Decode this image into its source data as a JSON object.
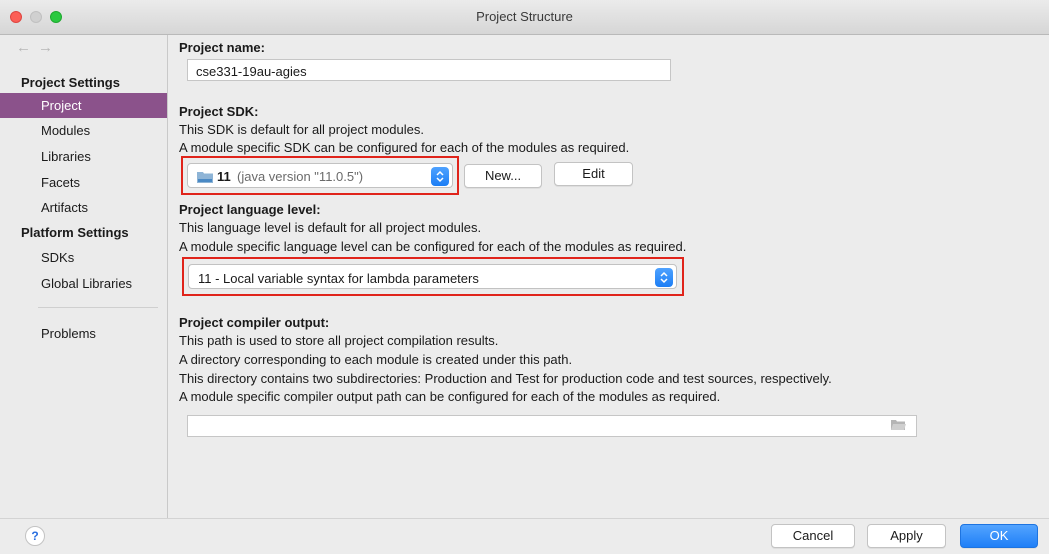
{
  "window": {
    "title": "Project Structure"
  },
  "nav": {
    "back": "←",
    "forward": "→"
  },
  "sidebar": {
    "project_settings_header": "Project Settings",
    "project_items": [
      {
        "label": "Project",
        "selected": true
      },
      {
        "label": "Modules"
      },
      {
        "label": "Libraries"
      },
      {
        "label": "Facets"
      },
      {
        "label": "Artifacts"
      }
    ],
    "platform_settings_header": "Platform Settings",
    "platform_items": [
      {
        "label": "SDKs"
      },
      {
        "label": "Global Libraries"
      }
    ],
    "problems": "Problems"
  },
  "project_name": {
    "label": "Project name:",
    "value": "cse331-19au-agies"
  },
  "sdk": {
    "label": "Project SDK:",
    "desc1": "This SDK is default for all project modules.",
    "desc2": "A module specific SDK can be configured for each of the modules as required.",
    "selected_version": "11",
    "selected_detail": "(java version \"11.0.5\")",
    "new_button": "New...",
    "edit_button": "Edit"
  },
  "language_level": {
    "label": "Project language level:",
    "desc1": "This language level is default for all project modules.",
    "desc2": "A module specific language level can be configured for each of the modules as required.",
    "selected": "11 - Local variable syntax for lambda parameters"
  },
  "compiler_output": {
    "label": "Project compiler output:",
    "desc1": "This path is used to store all project compilation results.",
    "desc2": "A directory corresponding to each module is created under this path.",
    "desc3": "This directory contains two subdirectories: Production and Test for production code and test sources, respectively.",
    "desc4": "A module specific compiler output path can be configured for each of the modules as required.",
    "value": ""
  },
  "footer": {
    "help": "?",
    "cancel": "Cancel",
    "apply": "Apply",
    "ok": "OK"
  },
  "colors": {
    "selection": "#8b528b",
    "highlight_box": "#e0241b",
    "primary_button": "#1f7ff7"
  }
}
